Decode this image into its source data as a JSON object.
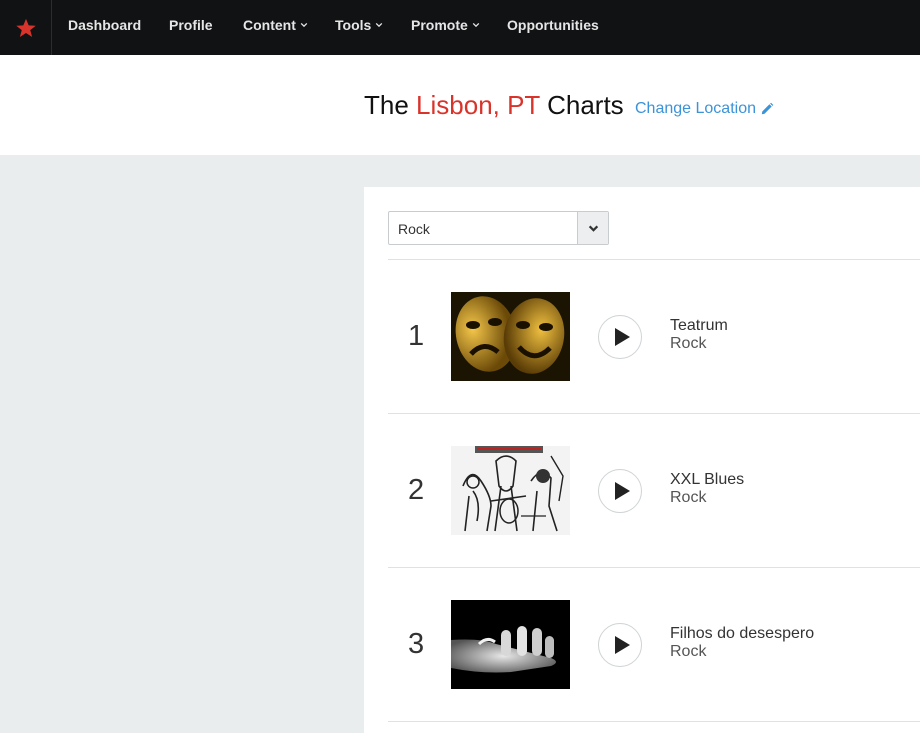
{
  "nav": {
    "logo": "star-icon",
    "items": [
      {
        "label": "Dashboard",
        "dropdown": false
      },
      {
        "label": "Profile",
        "dropdown": false
      },
      {
        "label": "Content",
        "dropdown": true
      },
      {
        "label": "Tools",
        "dropdown": true
      },
      {
        "label": "Promote",
        "dropdown": true
      },
      {
        "label": "Opportunities",
        "dropdown": false
      }
    ]
  },
  "header": {
    "title_prefix": "The ",
    "city": "Lisbon, PT",
    "title_suffix": " Charts",
    "change_location": "Change Location",
    "change_location_icon": "pencil-icon"
  },
  "filter": {
    "genre_selected": "Rock"
  },
  "chart": [
    {
      "rank": "1",
      "title": "Teatrum",
      "genre": "Rock"
    },
    {
      "rank": "2",
      "title": "XXL Blues",
      "genre": "Rock"
    },
    {
      "rank": "3",
      "title": "Filhos do desespero",
      "genre": "Rock"
    }
  ],
  "colors": {
    "nav_bg": "#111214",
    "accent_red": "#d9342b",
    "link_blue": "#3b93d8",
    "content_bg": "#e9edee"
  }
}
